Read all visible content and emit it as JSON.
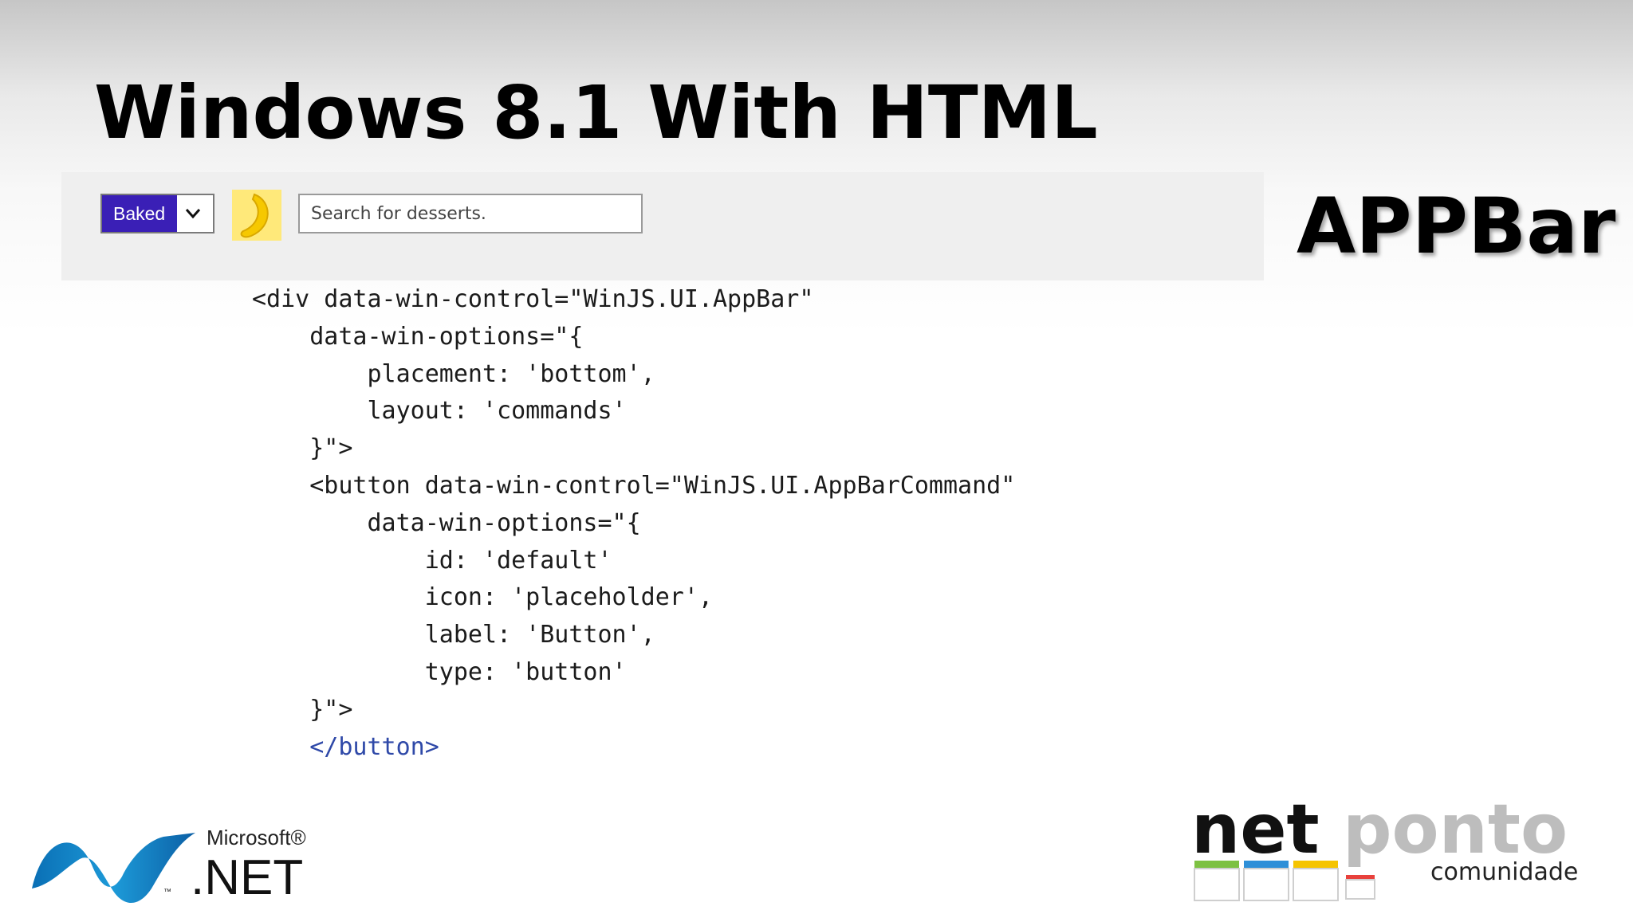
{
  "slide": {
    "title": "Windows 8.1 With HTML",
    "side_label": "APPBar"
  },
  "appbar_demo": {
    "select_value": "Baked",
    "search_placeholder": "Search for desserts.",
    "banana_icon": "banana-icon"
  },
  "code": {
    "lines": [
      "<div data-win-control=\"WinJS.UI.AppBar\"",
      "    data-win-options=\"{",
      "        placement: 'bottom',",
      "        layout: 'commands'",
      "    }\">",
      "    <button data-win-control=\"WinJS.UI.AppBarCommand\"",
      "        data-win-options=\"{",
      "            id: 'default'",
      "            icon: 'placeholder',",
      "            label: 'Button',",
      "            type: 'button'",
      "    }\">",
      "    </button>"
    ]
  },
  "logos": {
    "dotnet": {
      "brand_top": "Microsoft®",
      "brand_main": ".NET",
      "tm": "™"
    },
    "netponto": {
      "part1": "net",
      "part2": "ponto",
      "tagline": "comunidade"
    }
  },
  "colors": {
    "select_accent": "#3a1fb6",
    "banana_tile": "#ffe97a",
    "banana": "#f6c800",
    "netponto_green": "#7dc142",
    "netponto_blue": "#2e8fd8",
    "netponto_yellow": "#f5c400",
    "netponto_red": "#e8413c"
  }
}
